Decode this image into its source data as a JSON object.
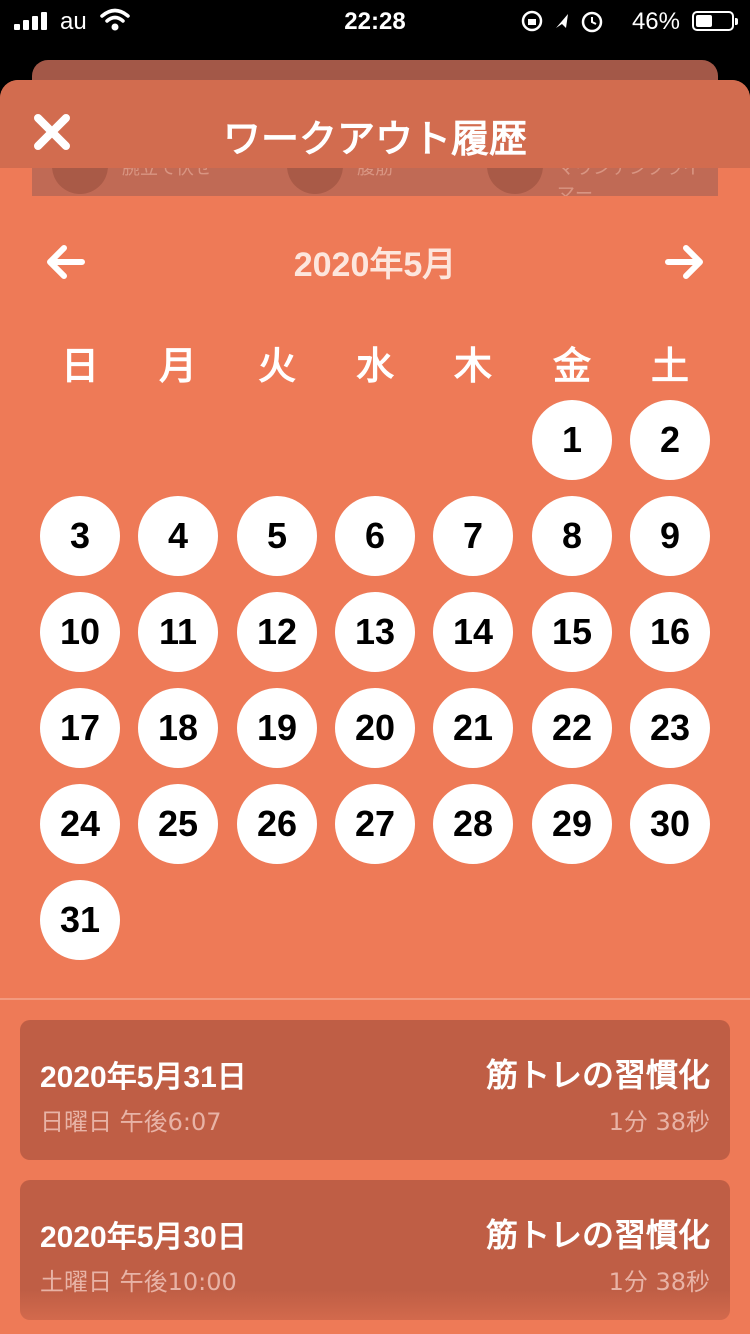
{
  "status_bar": {
    "carrier": "au",
    "time": "22:28",
    "battery": "46%",
    "battery_level": 0.46
  },
  "background_card": {
    "items": [
      "腕立て伏せ",
      "腹筋",
      "マウンテンクライマー"
    ]
  },
  "header": {
    "title": "ワークアウト履歴"
  },
  "calendar": {
    "month_label": "2020年5月",
    "weekdays": [
      "日",
      "月",
      "火",
      "水",
      "木",
      "金",
      "土"
    ],
    "first_weekday_index": 5,
    "days": [
      "1",
      "2",
      "3",
      "4",
      "5",
      "6",
      "7",
      "8",
      "9",
      "10",
      "11",
      "12",
      "13",
      "14",
      "15",
      "16",
      "17",
      "18",
      "19",
      "20",
      "21",
      "22",
      "23",
      "24",
      "25",
      "26",
      "27",
      "28",
      "29",
      "30",
      "31"
    ]
  },
  "history": [
    {
      "date": "2020年5月31日",
      "weekday_time": "日曜日 午後6:07",
      "workout": "筋トレの習慣化",
      "duration": "1分 38秒"
    },
    {
      "date": "2020年5月30日",
      "weekday_time": "土曜日 午後10:00",
      "workout": "筋トレの習慣化",
      "duration": "1分 38秒"
    }
  ],
  "colors": {
    "accent": "#ee7a57",
    "header": "#d26c4f",
    "entry": "#bf5e45"
  }
}
